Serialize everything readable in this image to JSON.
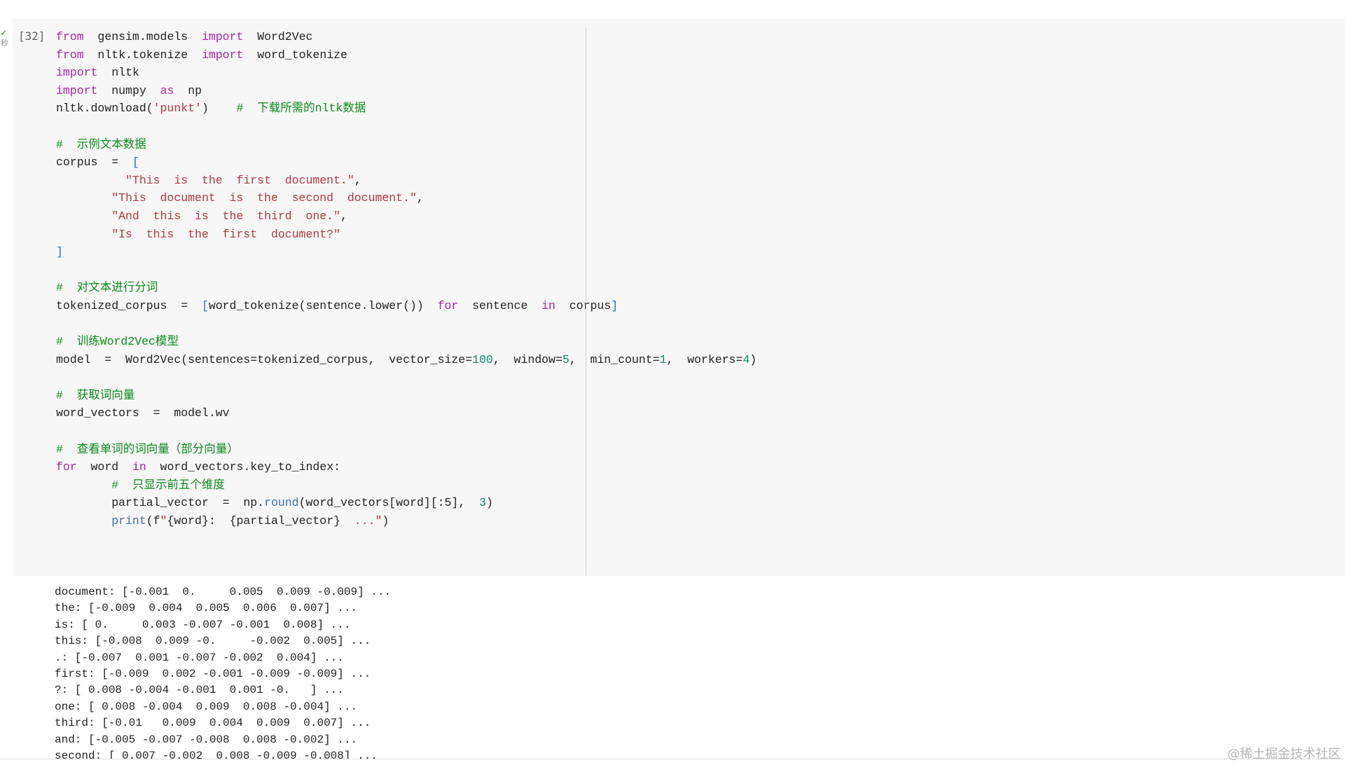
{
  "cell": {
    "execution_count": "[32]",
    "status_check": "✓",
    "status_secs": "秒",
    "code": {
      "l1_kw1": "from",
      "l1_t1": "gensim.models",
      "l1_kw2": "import",
      "l1_t2": "Word2Vec",
      "l2_kw1": "from",
      "l2_t1": "nltk.tokenize",
      "l2_kw2": "import",
      "l2_t2": "word_tokenize",
      "l3_kw": "import",
      "l3_t": "nltk",
      "l4_kw1": "import",
      "l4_t1": "numpy",
      "l4_kw2": "as",
      "l4_t2": "np",
      "l5_t": "nltk.download(",
      "l5_s": "'punkt'",
      "l5_t2": ")",
      "l5_c": "#  下载所需的nltk数据",
      "l7_c": "#  示例文本数据",
      "l8_t": "corpus  =  ",
      "l8_b": "[",
      "l9_s": "\"This  is  the  first  document.\"",
      "l9_t": ",",
      "l10_s": "\"This  document  is  the  second  document.\"",
      "l10_t": ",",
      "l11_s": "\"And  this  is  the  third  one.\"",
      "l11_t": ",",
      "l12_s": "\"Is  this  the  first  document?\"",
      "l13_b": "]",
      "l15_c": "#  对文本进行分词",
      "l16_t1": "tokenized_corpus  =  ",
      "l16_b1": "[",
      "l16_t2": "word_tokenize(sentence.lower())  ",
      "l16_kw1": "for",
      "l16_t3": "  sentence  ",
      "l16_kw2": "in",
      "l16_t4": "  corpus",
      "l16_b2": "]",
      "l18_c": "#  训练Word2Vec模型",
      "l19_t1": "model  =  Word2Vec(sentences=tokenized_corpus,  vector_size=",
      "l19_n1": "100",
      "l19_t2": ",  window=",
      "l19_n2": "5",
      "l19_t3": ",  min_count=",
      "l19_n3": "1",
      "l19_t4": ",  workers=",
      "l19_n4": "4",
      "l19_t5": ")",
      "l21_c": "#  获取词向量",
      "l22_t": "word_vectors  =  model.wv",
      "l24_c": "#  查看单词的词向量（部分向量）",
      "l25_kw1": "for",
      "l25_t1": "  word  ",
      "l25_kw2": "in",
      "l25_t2": "  word_vectors.key_to_index:",
      "l26_c": "#  只显示前五个维度",
      "l27_t1": "partial_vector  =  np.",
      "l27_f": "round",
      "l27_t2": "(word_vectors[word][:5],  ",
      "l27_n": "3",
      "l27_t3": ")",
      "l28_f": "print",
      "l28_t1": "(f",
      "l28_s1": "\"",
      "l28_t2": "{word}:  {partial_vector}",
      "l28_s2": "  ...\"",
      "l28_t3": ")"
    }
  },
  "output_lines": [
    "document: [-0.001  0.     0.005  0.009 -0.009] ...",
    "the: [-0.009  0.004  0.005  0.006  0.007] ...",
    "is: [ 0.     0.003 -0.007 -0.001  0.008] ...",
    "this: [-0.008  0.009 -0.     -0.002  0.005] ...",
    ".: [-0.007  0.001 -0.007 -0.002  0.004] ...",
    "first: [-0.009  0.002 -0.001 -0.009 -0.009] ...",
    "?: [ 0.008 -0.004 -0.001  0.001 -0.   ] ...",
    "one: [ 0.008 -0.004  0.009  0.008 -0.004] ...",
    "third: [-0.01   0.009  0.004  0.009  0.007] ...",
    "and: [-0.005 -0.007 -0.008  0.008 -0.002] ...",
    "second: [ 0.007 -0.002  0.008 -0.009 -0.008] ..."
  ],
  "watermark": "@稀土掘金技术社区"
}
